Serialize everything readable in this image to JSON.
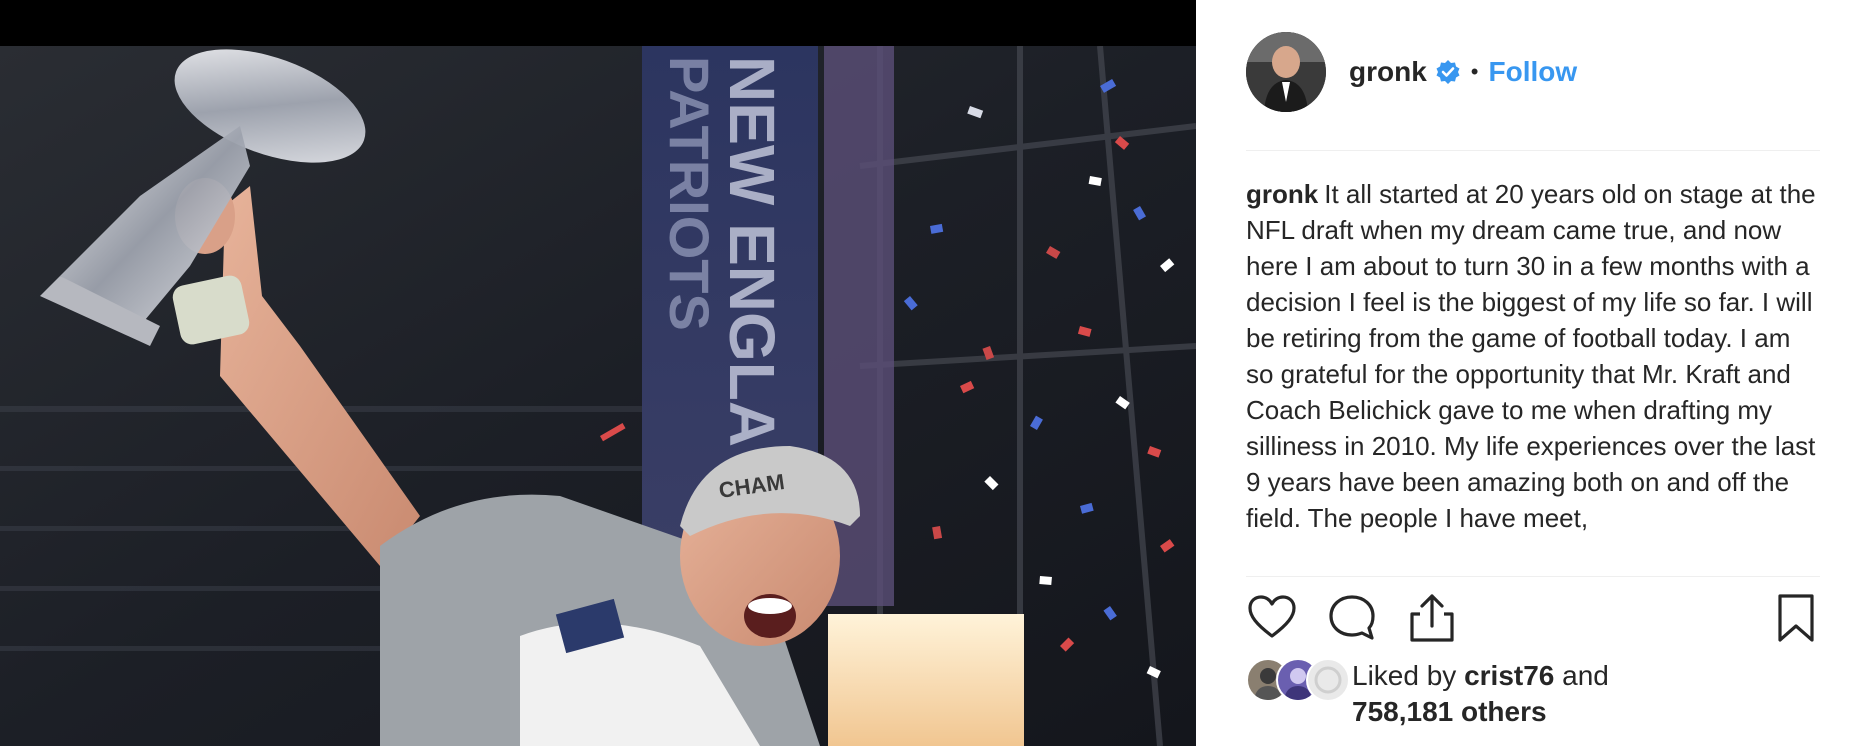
{
  "post": {
    "username": "gronk",
    "verified_icon": "verified-badge-icon",
    "separator": "•",
    "follow_label": "Follow",
    "caption_user": "gronk",
    "caption_text": "It all started at 20 years old on stage at the NFL draft when my dream came true, and now here I am about to turn 30 in a few months with a decision I feel is the biggest of my life so far. I will be retiring from the game of football today. I am so grateful for the opportunity that Mr. Kraft and Coach Belichick gave to me when drafting my silliness in 2010. My life experiences over the last 9 years have been amazing both on and off the field. The people I have meet,",
    "likes_prefix": "Liked by",
    "likes_user": "crist76",
    "likes_and": "and",
    "likes_count": "758,181 others"
  },
  "photo": {
    "banner_text": "NEW ENGLA",
    "banner_text2": "PATRIOTS",
    "cap_text": "CHAM"
  },
  "icons": {
    "like": "heart-icon",
    "comment": "comment-icon",
    "share": "share-icon",
    "save": "bookmark-icon"
  },
  "colors": {
    "follow": "#3897f0",
    "verified": "#3897f0",
    "text": "#262626",
    "divider": "#efefef"
  }
}
